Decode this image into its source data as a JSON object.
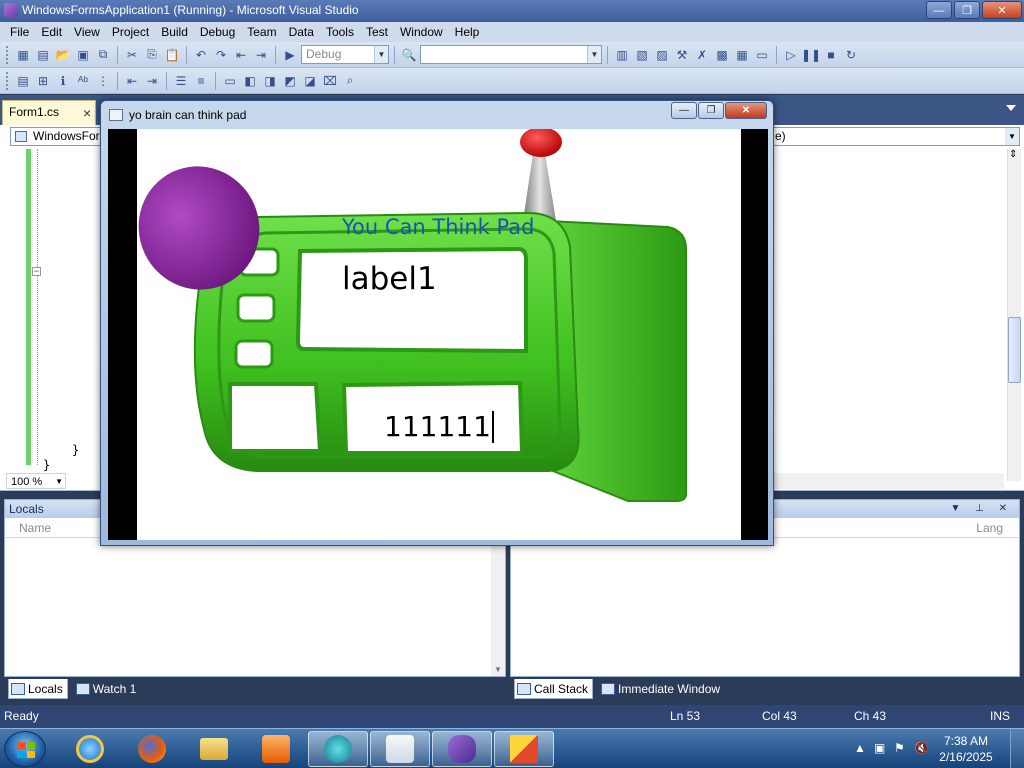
{
  "vs": {
    "title": "WindowsFormsApplication1 (Running) - Microsoft Visual Studio",
    "caption": {
      "minimize": "—",
      "restore": "❐",
      "close": "✕"
    },
    "menu": [
      "File",
      "Edit",
      "View",
      "Project",
      "Build",
      "Debug",
      "Team",
      "Data",
      "Tools",
      "Test",
      "Window",
      "Help"
    ],
    "toolbar": {
      "config_combo": "Debug",
      "search_combo": ""
    },
    "doc_tab": {
      "label": "Form1.cs",
      "close": "×"
    },
    "editor": {
      "nav_left": "WindowsForms",
      "nav_right": "e)",
      "fold_symbol": "−",
      "brace1": "}",
      "brace2": "}",
      "zoom": "100 %"
    }
  },
  "locals": {
    "title": "Locals",
    "col_name": "Name"
  },
  "callstack": {
    "col_lang": "Lang"
  },
  "bottom_tabs_left": [
    "Locals",
    "Watch 1"
  ],
  "bottom_tabs_right": [
    "Call Stack",
    "Immediate Window"
  ],
  "status": {
    "ready": "Ready",
    "ln": "Ln 53",
    "col": "Col 43",
    "ch": "Ch 43",
    "ins": "INS"
  },
  "taskbar": {
    "time": "7:38 AM",
    "date": "2/16/2025"
  },
  "app": {
    "title": "yo brain can think pad",
    "pad_title": "You Can Think Pad",
    "label1": "label1",
    "input_value": "111111"
  },
  "colors": {
    "pad_green": "#3fbf1f",
    "pad_title_blue": "#1a52b8",
    "knob_purple": "#8a2aa0",
    "antenna_tip": "#d21a1a"
  }
}
